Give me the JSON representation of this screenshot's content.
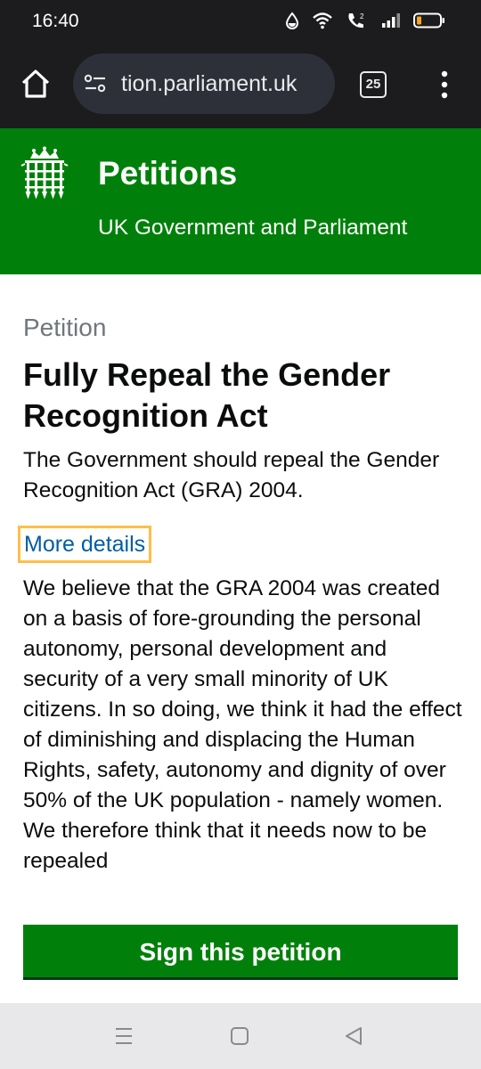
{
  "status_bar": {
    "time": "16:40"
  },
  "browser": {
    "url_faded": "",
    "url_text": "tion.parliament.uk",
    "tab_count": "25"
  },
  "header": {
    "title": "Petitions",
    "subtitle": "UK Government and Parliament"
  },
  "petition": {
    "caption": "Petition",
    "title": "Fully Repeal the Gender Recognition Act",
    "action": "The Government should repeal the Gender Recognition Act (GRA) 2004.",
    "details_link": "More details",
    "body": "We believe that the GRA 2004 was created on a basis of fore-grounding the personal autonomy, personal development and security of a very small minority of UK citizens. In so doing, we think it had the effect of diminishing and displacing the Human Rights, safety, autonomy and dignity of over 50% of the UK population - namely women. We therefore think that it needs now to be repealed",
    "sign_button": "Sign this petition"
  },
  "colors": {
    "brand_green": "#00800a",
    "link_blue": "#005ea5",
    "focus_yellow": "#ffbf47",
    "browser_dark": "#1c1c1e"
  },
  "icons": {
    "status": [
      "droplet-icon",
      "wifi-icon",
      "volte-call-icon",
      "signal-icon",
      "battery-icon"
    ],
    "browser": [
      "home-icon",
      "site-settings-icon",
      "tabs-icon",
      "more-vert-icon"
    ],
    "header": "portcullis-icon",
    "nav": [
      "recents-icon",
      "home-nav-icon",
      "back-icon"
    ]
  }
}
